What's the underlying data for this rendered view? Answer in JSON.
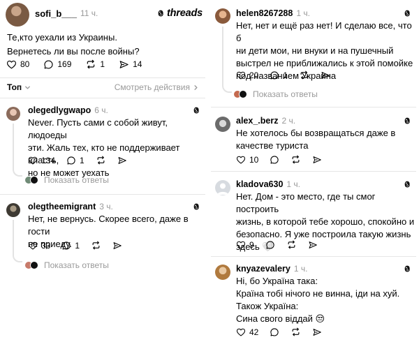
{
  "post": {
    "author": "sofi_b___",
    "time": "11 ч.",
    "brand": "threads",
    "lines": [
      "Те,кто уехали из Украины.",
      "Вернетесь ли вы после войны?"
    ],
    "likes": "80",
    "comments": "169",
    "reposts": "1",
    "shares": "14"
  },
  "sort": {
    "label": "Топ",
    "view_actions": "Смотреть действия"
  },
  "replies_label": "Показать ответы",
  "left_comments": [
    {
      "author": "olegedlygwapo",
      "time": "6 ч.",
      "lines": [
        "Never. Пусть сами с собой живут, людоеды",
        "эти. Жаль тех, кто не поддерживает власть,",
        "но не может уехать"
      ],
      "likes": "134",
      "comments": "1"
    },
    {
      "author": "olegtheemigrant",
      "time": "3 ч.",
      "lines": [
        "Нет, не вернусь. Скорее всего, даже в гости",
        "не приеду."
      ],
      "likes": "33",
      "comments": "1"
    }
  ],
  "right_comments": [
    {
      "author": "helen8267288",
      "time": "1 ч.",
      "lines": [
        "Нет, нет и ещё раз нет! И сделаю все, что б",
        "ни дети мои, ни внуки и на пушечный",
        "выстрел не приближались к этой помойке",
        "под названием Украина"
      ],
      "likes": "20",
      "comments": "1"
    },
    {
      "author": "alex_.berz",
      "time": "2 ч.",
      "lines": [
        "Не хотелось бы возвращаться даже в",
        "качестве туриста"
      ],
      "likes": "10"
    },
    {
      "author": "kladova630",
      "time": "1 ч.",
      "lines": [
        "Нет. Дом - это место, где ты смог построить",
        "жизнь, в которой тебе хорошо, спокойно и",
        "безопасно. Я уже построила такую жизнь",
        "здесь 🤍"
      ],
      "likes": "9"
    },
    {
      "author": "knyazevalery",
      "time": "1 ч.",
      "lines": [
        "Ні, бо Україна така:",
        "Країна тобі нічого не винна, іди на хуй.",
        "Також Україна:",
        "Сина свого віддай 😒"
      ],
      "likes": "42"
    }
  ],
  "colors": {
    "text": "#000000",
    "muted": "#999999",
    "divider": "#e6e6e6",
    "thread_line": "#e3e3e3"
  }
}
